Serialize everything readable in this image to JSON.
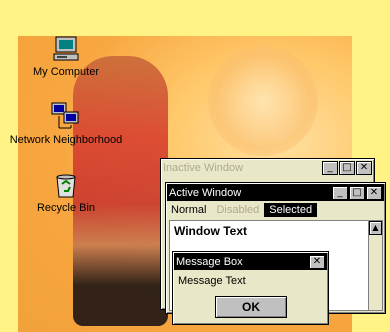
{
  "desktop": {
    "icons": [
      {
        "label": "My Computer",
        "icon": "computer-icon"
      },
      {
        "label": "Network Neighborhood",
        "icon": "network-icon"
      },
      {
        "label": "Recycle Bin",
        "icon": "recycle-bin-icon"
      }
    ]
  },
  "inactive_window": {
    "title": "Inactive Window"
  },
  "active_window": {
    "title": "Active Window",
    "menu": {
      "normal": "Normal",
      "disabled": "Disabled",
      "selected": "Selected"
    },
    "body_text": "Window Text"
  },
  "message_box": {
    "title": "Message Box",
    "text": "Message Text",
    "ok_label": "OK"
  },
  "controls": {
    "minimize": "_",
    "maximize": "□",
    "close": "✕"
  },
  "colors": {
    "desktop_bg": "#fff385",
    "inactive_title_bg": "#e8e8c8",
    "inactive_title_text": "#b0a890",
    "active_title_bg": "#000000",
    "active_title_text": "#ffffff",
    "selected_bg": "#000000",
    "disabled_text": "#b0a890"
  }
}
